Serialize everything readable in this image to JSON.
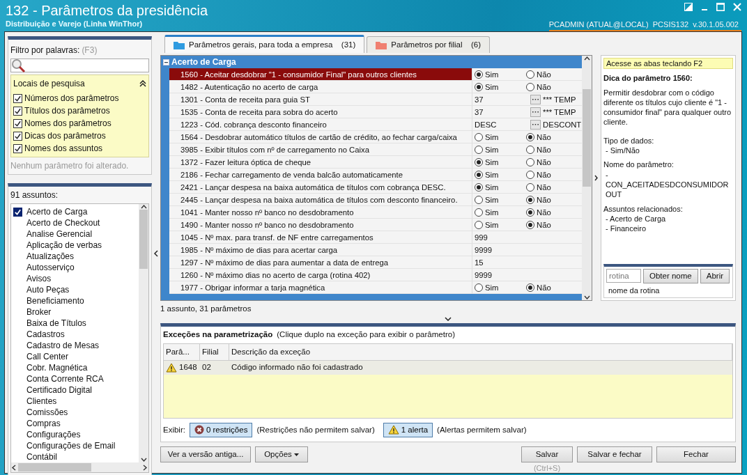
{
  "window": {
    "title": "132 - Parâmetros da presidência",
    "subtitle": "Distribuição e Varejo (Linha WinThor)",
    "user": "PCADMIN (ATUAL@LOCAL)",
    "program": "PCSIS132",
    "version": "v.30.1.05.002"
  },
  "filter": {
    "label": "Filtro por palavras:",
    "shortcut": "(F3)",
    "search_locations_title": "Locais de pesquisa",
    "options": [
      {
        "label": "Números dos parâmetros",
        "checked": true
      },
      {
        "label": "Títulos dos parâmetros",
        "checked": true
      },
      {
        "label": "Nomes dos parâmetros",
        "checked": true
      },
      {
        "label": "Dicas dos parâmetros",
        "checked": true
      },
      {
        "label": "Nomes dos assuntos",
        "checked": true
      }
    ],
    "status": "Nenhum parâmetro foi alterado."
  },
  "subjects": {
    "title": "91 assuntos:",
    "items": [
      {
        "label": "Acerto de Carga",
        "checked": true
      },
      {
        "label": "Acerto de Checkout",
        "checked": false
      },
      {
        "label": "Analise Gerencial",
        "checked": false
      },
      {
        "label": "Aplicação de verbas",
        "checked": false
      },
      {
        "label": "Atualizações",
        "checked": false
      },
      {
        "label": "Autosserviço",
        "checked": false
      },
      {
        "label": "Avisos",
        "checked": false
      },
      {
        "label": "Auto Peças",
        "checked": false
      },
      {
        "label": "Beneficiamento",
        "checked": false
      },
      {
        "label": "Broker",
        "checked": false
      },
      {
        "label": "Baixa de Títulos",
        "checked": false
      },
      {
        "label": "Cadastros",
        "checked": false
      },
      {
        "label": "Cadastro de Mesas",
        "checked": false
      },
      {
        "label": "Call Center",
        "checked": false
      },
      {
        "label": "Cobr. Magnética",
        "checked": false
      },
      {
        "label": "Conta Corrente RCA",
        "checked": false
      },
      {
        "label": "Certificado Digital",
        "checked": false
      },
      {
        "label": "Clientes",
        "checked": false
      },
      {
        "label": "Comissões",
        "checked": false
      },
      {
        "label": "Compras",
        "checked": false
      },
      {
        "label": "Configurações",
        "checked": false
      },
      {
        "label": "Configurações de Email",
        "checked": false
      },
      {
        "label": "Contábil",
        "checked": false
      }
    ]
  },
  "tabs": [
    {
      "label": "Parâmetros gerais, para toda a empresa",
      "count": "(31)",
      "selected": true,
      "color": "#2f9be0"
    },
    {
      "label": "Parâmetros por filial",
      "count": "(6)",
      "selected": false,
      "color": "#f08070"
    }
  ],
  "grid": {
    "group": "Acerto de Carga",
    "rows": [
      {
        "label": "1560 - Aceitar desdobrar \"1 - consumidor Final\" para outros clientes",
        "kind": "yesno",
        "selected": true,
        "options": [
          {
            "label": "Sim",
            "selected": true
          },
          {
            "label": "Não",
            "selected": false
          }
        ]
      },
      {
        "label": "1482 - Autenticação no acerto de carga",
        "kind": "yesno",
        "selected": false,
        "options": [
          {
            "label": "Sim",
            "selected": true
          },
          {
            "label": "Não",
            "selected": false
          }
        ]
      },
      {
        "label": "1301 - Conta de receita para guia ST",
        "kind": "lookup",
        "selected": false,
        "value": "37",
        "lookup_text": "*** TEMP"
      },
      {
        "label": "1535 - Conta de receita para sobra do acerto",
        "kind": "lookup",
        "selected": false,
        "value": "37",
        "lookup_text": "*** TEMP"
      },
      {
        "label": "1223 - Cód. cobrança desconto financeiro",
        "kind": "lookup",
        "selected": false,
        "value": "DESC",
        "lookup_text": "DESCONT"
      },
      {
        "label": "1564 - Desdobrar automático títulos de cartão de crédito, ao fechar carga/caixa",
        "kind": "yesno",
        "selected": false,
        "options": [
          {
            "label": "Sim",
            "selected": false
          },
          {
            "label": "Não",
            "selected": true
          }
        ]
      },
      {
        "label": "3985 - Exibir títulos com nº de carregamento no Caixa",
        "kind": "yesno",
        "selected": false,
        "options": [
          {
            "label": "Sim",
            "selected": false
          },
          {
            "label": "Não",
            "selected": false
          }
        ]
      },
      {
        "label": "1372 - Fazer leitura óptica de cheque",
        "kind": "yesno",
        "selected": false,
        "options": [
          {
            "label": "Sim",
            "selected": true
          },
          {
            "label": "Não",
            "selected": false
          }
        ]
      },
      {
        "label": "2186 - Fechar carregamento de venda balcão automaticamente",
        "kind": "yesno",
        "selected": false,
        "options": [
          {
            "label": "Sim",
            "selected": true
          },
          {
            "label": "Não",
            "selected": false
          }
        ]
      },
      {
        "label": "2421 - Lançar despesa na baixa automática de títulos com cobrança DESC.",
        "kind": "yesno",
        "selected": false,
        "options": [
          {
            "label": "Sim",
            "selected": true
          },
          {
            "label": "Não",
            "selected": false
          }
        ]
      },
      {
        "label": "2445 - Lançar despesa na baixa automática de títulos com desconto financeiro.",
        "kind": "yesno",
        "selected": false,
        "options": [
          {
            "label": "Sim",
            "selected": false
          },
          {
            "label": "Não",
            "selected": true
          }
        ]
      },
      {
        "label": "1041 - Manter nosso nº banco no desdobramento",
        "kind": "yesno",
        "selected": false,
        "options": [
          {
            "label": "Sim",
            "selected": false
          },
          {
            "label": "Não",
            "selected": true
          }
        ]
      },
      {
        "label": "1490 - Manter nosso nº banco no desdobramento",
        "kind": "yesno",
        "selected": false,
        "options": [
          {
            "label": "Sim",
            "selected": false
          },
          {
            "label": "Não",
            "selected": true
          }
        ]
      },
      {
        "label": "1045 - Nº max. para transf. de NF entre carregamentos",
        "kind": "text",
        "selected": false,
        "value": "999"
      },
      {
        "label": "1985 - Nº máximo de dias para acertar carga",
        "kind": "text",
        "selected": false,
        "value": "9999"
      },
      {
        "label": "1297 - Nº máximo de dias para aumentar a data de entrega",
        "kind": "text",
        "selected": false,
        "value": "15"
      },
      {
        "label": "1260 - Nº máximo dias no acerto de carga (rotina 402)",
        "kind": "text",
        "selected": false,
        "value": "9999"
      },
      {
        "label": "1977 - Obrigar informar a tarja magnética",
        "kind": "yesno",
        "selected": false,
        "options": [
          {
            "label": "Sim",
            "selected": false
          },
          {
            "label": "Não",
            "selected": true
          }
        ]
      }
    ],
    "status": "1 assunto, 31 parâmetros"
  },
  "hint": {
    "banner": "Acesse as abas teclando F2",
    "title": "Dica do parâmetro 1560:",
    "description": "Permitir desdobrar com o código diferente os títulos cujo cliente é \"1 - consumidor final\" para qualquer outro cliente.",
    "sections": [
      {
        "heading": "Tipo de dados:",
        "lines": [
          "- Sim/Não"
        ]
      },
      {
        "heading": "Nome do parâmetro:",
        "lines": [
          "-",
          "CON_ACEITADESDCONSUMIDOROUT"
        ]
      },
      {
        "heading": "Assuntos relacionados:",
        "lines": [
          "- Acerto de Carga",
          "- Financeiro"
        ]
      }
    ],
    "routine_placeholder": "rotina",
    "get_name_button": "Obter nome",
    "open_button": "Abrir",
    "routine_name": "nome da rotina"
  },
  "exceptions": {
    "title": "Exceções na parametrização",
    "instruction": "(Clique duplo na exceção para exibir o parâmetro)",
    "columns": [
      "Parâ...",
      "Filial",
      "Descrição da exceção"
    ],
    "rows": [
      {
        "kind": "warning",
        "cells": [
          "1648",
          "02",
          "Código informado não foi cadastrado"
        ]
      }
    ],
    "show_label": "Exibir:",
    "toggles": [
      {
        "kind": "error",
        "label": "0 restrições",
        "note": "(Restrições não permitem salvar)"
      },
      {
        "kind": "warning",
        "label": "1 alerta",
        "note": "(Alertas permitem salvar)"
      }
    ]
  },
  "buttons": {
    "old_version": "Ver a versão antiga...",
    "options": "Opções",
    "save": "Salvar",
    "save_shortcut": "(Ctrl+S)",
    "save_close": "Salvar e fechar",
    "close": "Fechar"
  }
}
